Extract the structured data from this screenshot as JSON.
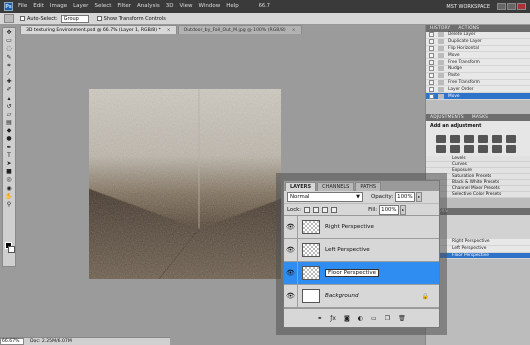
{
  "app": {
    "logo": "Ps",
    "workspace": "MST WORKSPACE"
  },
  "menu": [
    "File",
    "Edit",
    "Image",
    "Layer",
    "Select",
    "Filter",
    "Analysis",
    "3D",
    "View",
    "Window",
    "Help"
  ],
  "zoom_menu": "66.7",
  "options": {
    "auto_select_label": "Auto-Select:",
    "auto_select_value": "Group",
    "transform_label": "Show Transform Controls"
  },
  "tabs": [
    {
      "label": "3D texturing Environment.psd @ 66.7% (Layer 1, RGB/8) *",
      "active": true
    },
    {
      "label": "Outdoor_by_Fall_Out_M.jpg @ 100% (RGB/8)",
      "active": false
    }
  ],
  "status": {
    "zoom": "66.67%",
    "doc": "Doc: 2.25M/6.07M"
  },
  "history": {
    "tab_history": "HISTORY",
    "tab_actions": "ACTIONS",
    "items": [
      "Delete Layer",
      "Duplicate Layer",
      "Flip Horizontal",
      "Move",
      "Free Transform",
      "Nudge",
      "Paste",
      "Free Transform",
      "Layer Order",
      "Move"
    ]
  },
  "adjustments": {
    "tab_adj": "ADJUSTMENTS",
    "tab_masks": "MASKS",
    "title": "Add an adjustment",
    "presets": [
      "Levels",
      "Curves",
      "Exposure",
      "Saturation Presets",
      "Black & White Presets",
      "Channel Mixer Presets",
      "Selective Color Presets"
    ]
  },
  "mini_layers": [
    "Right Perspective",
    "Left Perspective",
    "Floor Perspective"
  ],
  "layers_panel": {
    "tabs": [
      "LAYERS",
      "CHANNELS",
      "PATHS"
    ],
    "blend_mode": "Normal",
    "opacity_label": "Opacity:",
    "opacity": "100%",
    "lock_label": "Lock:",
    "fill_label": "Fill:",
    "fill": "100%",
    "layers": [
      {
        "name": "Right Perspective",
        "selected": false,
        "background": false
      },
      {
        "name": "Left Perspective",
        "selected": false,
        "background": false
      },
      {
        "name": "Floor Perspective",
        "selected": true,
        "background": false
      },
      {
        "name": "Background",
        "selected": false,
        "background": true
      }
    ]
  },
  "colors": {
    "selection": "#2f8cf0",
    "menubar": "#3a3a3a",
    "panel": "#d7d7d7"
  }
}
